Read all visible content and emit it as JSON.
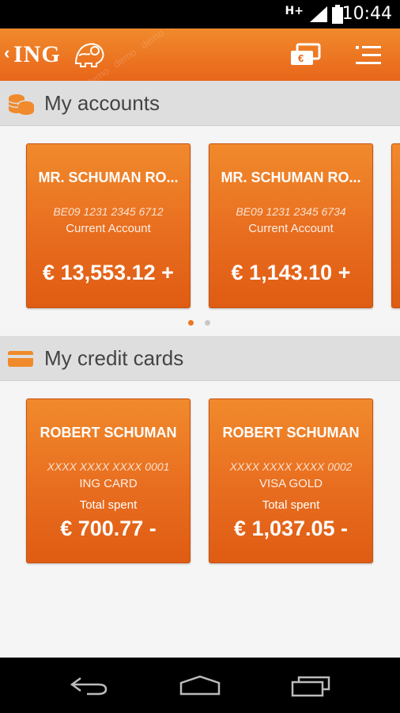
{
  "status_bar": {
    "network": "H+",
    "time": "10:44"
  },
  "app_bar": {
    "logo": "ING",
    "watermark": "demo demo demo demo demo demo demo demo demo demo demo demo demo demo demo demo demo demo demo demo demo demo demo demo demo demo demo demo demo demo demo demo demo demo demo demo demo demo demo demo demo demo demo demo demo demo demo demo demo demo demo demo demo demo demo demo demo demo demo demo demo demo demo demo demo demo demo demo demo demo demo demo demo demo demo demo demo"
  },
  "accounts": {
    "title": "My accounts",
    "items": [
      {
        "name": "MR. SCHUMAN RO...",
        "number": "BE09 1231 2345 6712",
        "type": "Current Account",
        "balance": "€ 13,553.12 +"
      },
      {
        "name": "MR. SCHUMAN RO...",
        "number": "BE09 1231 2345 6734",
        "type": "Current Account",
        "balance": "€ 1,143.10 +"
      }
    ],
    "pager": {
      "pages": 2,
      "active": 0
    }
  },
  "credit_cards": {
    "title": "My credit cards",
    "items": [
      {
        "name": "ROBERT SCHUMAN",
        "number": "XXXX XXXX XXXX 0001",
        "type": "ING CARD",
        "spent_label": "Total spent",
        "amount": "€ 700.77 -"
      },
      {
        "name": "ROBERT SCHUMAN",
        "number": "XXXX XXXX XXXX 0002",
        "type": "VISA GOLD",
        "spent_label": "Total spent",
        "amount": "€ 1,037.05 -"
      }
    ]
  },
  "colors": {
    "brand_orange": "#ee7623",
    "pager_active": "#ee7623",
    "pager_inactive": "#c8c8c8"
  }
}
